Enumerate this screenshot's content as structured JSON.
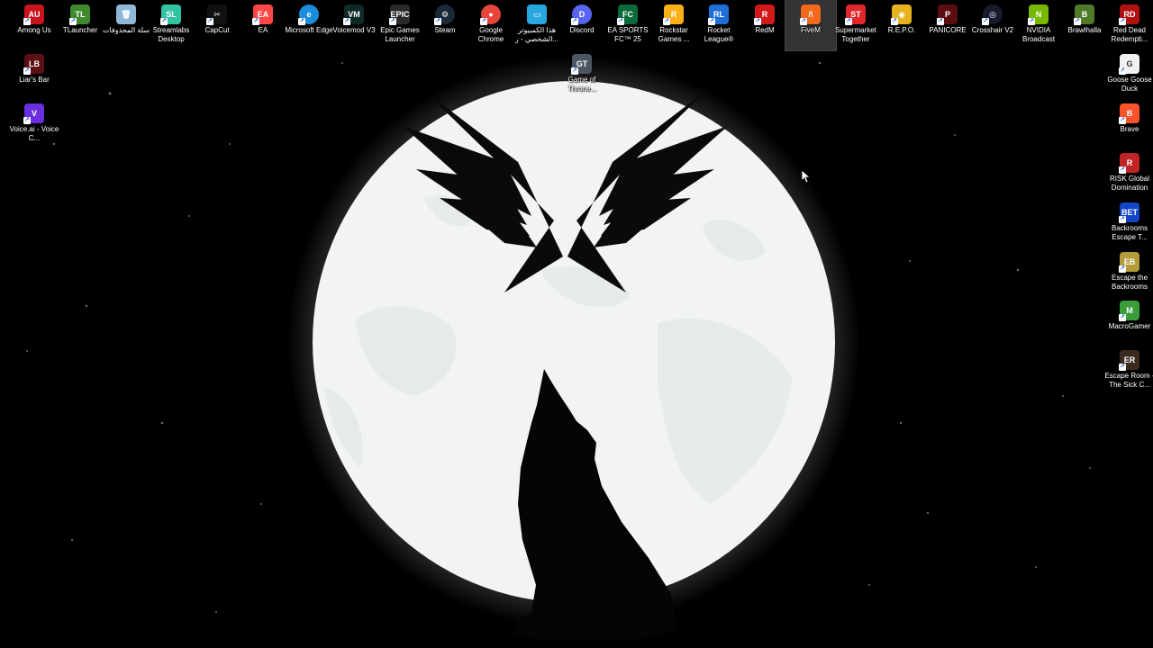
{
  "colors": {
    "moon": "#f2f4f4",
    "sky": "#000000",
    "silhouette": "#050505"
  },
  "icons": [
    {
      "label": "Among Us",
      "color": "#c8141c",
      "glyph": "AU",
      "name": "among-us-icon"
    },
    {
      "label": "TLauncher",
      "color": "#3f8a2c",
      "glyph": "TL",
      "name": "tlauncher-icon"
    },
    {
      "label": "سلة المحذوفات",
      "color": "#8fb8d8",
      "glyph": "🗑",
      "name": "recycle-bin-icon"
    },
    {
      "label": "Streamlabs Desktop",
      "color": "#31c3a2",
      "glyph": "SL",
      "name": "streamlabs-icon"
    },
    {
      "label": "CapCut",
      "color": "#111111",
      "glyph": "✂",
      "name": "capcut-icon"
    },
    {
      "label": "EA",
      "color": "#ff4747",
      "glyph": "EA",
      "name": "ea-icon"
    },
    {
      "label": "Microsoft Edge",
      "color": "#1b8ddc",
      "glyph": "e",
      "name": "edge-icon"
    },
    {
      "label": "Voicemod V3",
      "color": "#0d2a26",
      "glyph": "VM",
      "name": "voicemod-icon"
    },
    {
      "label": "Epic Games Launcher",
      "color": "#2a2a2a",
      "glyph": "EPIC",
      "name": "epic-games-icon"
    },
    {
      "label": "Steam",
      "color": "#1b2838",
      "glyph": "⚙",
      "name": "steam-icon"
    },
    {
      "label": "Google Chrome",
      "color": "#e8453c",
      "glyph": "●",
      "name": "chrome-icon"
    },
    {
      "label": "هذا الكمبيوتر الشخصي - ر...",
      "color": "#29a8e0",
      "glyph": "▭",
      "name": "this-pc-icon"
    },
    {
      "label": "Discord",
      "color": "#5865f2",
      "glyph": "D",
      "name": "discord-icon"
    },
    {
      "label": "EA SPORTS FC™ 25",
      "color": "#0c6b3a",
      "glyph": "FC",
      "name": "ea-fc25-icon"
    },
    {
      "label": "Rockstar Games ...",
      "color": "#fcaf17",
      "glyph": "R",
      "name": "rockstar-icon"
    },
    {
      "label": "Rocket League®",
      "color": "#1e6fd8",
      "glyph": "RL",
      "name": "rocket-league-icon"
    },
    {
      "label": "RedM",
      "color": "#d21919",
      "glyph": "R",
      "name": "redm-icon"
    },
    {
      "label": "FiveM",
      "color": "#f26a1b",
      "glyph": "/\\",
      "name": "fivem-icon"
    },
    {
      "label": "Supermarket Together",
      "color": "#e0282c",
      "glyph": "ST",
      "name": "supermarket-together-icon"
    },
    {
      "label": "R.E.P.O.",
      "color": "#e6b31e",
      "glyph": "◉",
      "name": "repo-icon"
    },
    {
      "label": "PANICORE",
      "color": "#5a0e12",
      "glyph": "P",
      "name": "panicore-icon"
    },
    {
      "label": "Crosshair V2",
      "color": "#1a1a2e",
      "glyph": "◎",
      "name": "crosshair-icon"
    },
    {
      "label": "NVIDIA Broadcast",
      "color": "#76b900",
      "glyph": "N",
      "name": "nvidia-broadcast-icon"
    },
    {
      "label": "Brawlhalla",
      "color": "#4e7a2a",
      "glyph": "B",
      "name": "brawlhalla-icon"
    },
    {
      "label": "Red Dead Redempti...",
      "color": "#b01111",
      "glyph": "RD",
      "name": "red-dead-icon"
    },
    {
      "label": "Liar's Bar",
      "color": "#5c1016",
      "glyph": "LB",
      "name": "liars-bar-icon"
    },
    {
      "label": "Voice.ai - Voice C...",
      "color": "#6b2ee0",
      "glyph": "V",
      "name": "voice-ai-icon"
    },
    {
      "label": "Game of Throne...",
      "color": "#4b5563",
      "glyph": "GT",
      "name": "game-of-thrones-icon"
    },
    {
      "label": "Goose Goose Duck",
      "color": "#f2f2f2",
      "glyph": "G",
      "name": "goose-goose-duck-icon"
    },
    {
      "label": "Brave",
      "color": "#fb542b",
      "glyph": "B",
      "name": "brave-icon"
    },
    {
      "label": "RISK Global Domination",
      "color": "#c02424",
      "glyph": "R",
      "name": "risk-icon"
    },
    {
      "label": "Backrooms Escape T...",
      "color": "#1446c8",
      "glyph": "BET",
      "name": "backrooms-escape-together-icon"
    },
    {
      "label": "Escape the Backrooms",
      "color": "#b59a3a",
      "glyph": "EB",
      "name": "escape-the-backrooms-icon"
    },
    {
      "label": "MacroGamer",
      "color": "#3a9d3a",
      "glyph": "M",
      "name": "macrogamer-icon"
    },
    {
      "label": "Escape Room - The Sick C...",
      "color": "#3b2a1e",
      "glyph": "ER",
      "name": "escape-room-icon"
    }
  ]
}
